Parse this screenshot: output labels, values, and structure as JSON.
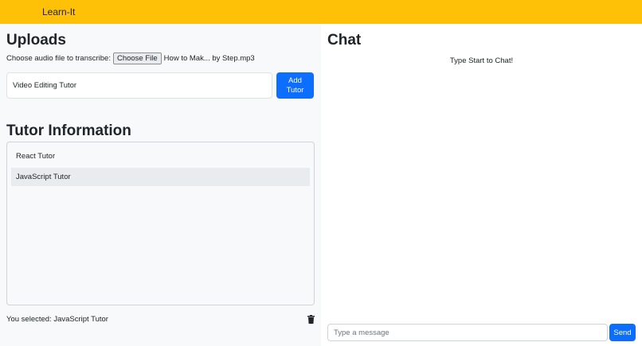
{
  "navbar": {
    "brand": "Learn-It"
  },
  "uploads": {
    "title": "Uploads",
    "file_label": "Choose audio file to transcribe:",
    "choose_button": "Choose File",
    "file_name": "How to Mak... by Step.mp3",
    "tutor_input_value": "Video Editing Tutor",
    "add_button_line1": "Add",
    "add_button_line2": "Tutor"
  },
  "tutors": {
    "title": "Tutor Information",
    "items": [
      {
        "label": "React Tutor"
      },
      {
        "label": "JavaScript Tutor"
      }
    ],
    "selected_text": "You selected: JavaScript Tutor",
    "delete_icon": "trash-icon"
  },
  "chat": {
    "title": "Chat",
    "hint": "Type Start to Chat!",
    "input_placeholder": "Type a message",
    "send_button": "Send"
  },
  "colors": {
    "navbar": "#ffc107",
    "primary": "#0d6efd",
    "panel": "#f8f9fa",
    "selected_item": "#e9ecef"
  }
}
